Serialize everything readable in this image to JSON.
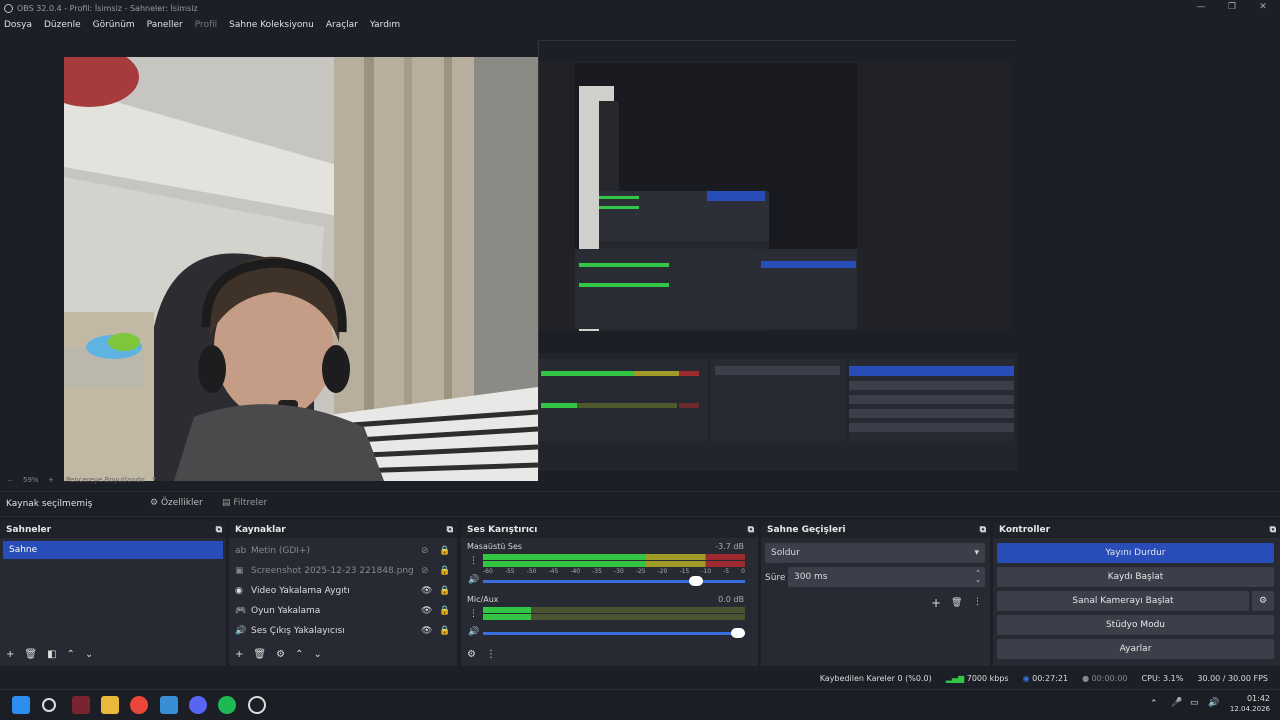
{
  "window": {
    "title": "OBS 32.0.4 - Profil: İsimsiz - Sahneler: İsimsiz",
    "controls": [
      "—",
      "❐",
      "✕"
    ]
  },
  "menu": [
    "Dosya",
    "Düzenle",
    "Görünüm",
    "Paneller",
    "Profil",
    "Sahne Koleksiyonu",
    "Araçlar",
    "Yardım"
  ],
  "preview": {
    "zoom": "59%",
    "fit_label": "Pencereye Boyutlandır"
  },
  "source_toolbar": {
    "status": "Kaynak seçilmemiş",
    "properties": "Özellikler",
    "filters": "Filtreler"
  },
  "scenes": {
    "title": "Sahneler",
    "items": [
      "Sahne"
    ]
  },
  "sources": {
    "title": "Kaynaklar",
    "items": [
      {
        "label": "Metin (GDI+)",
        "icon": "text-icon",
        "hidden": true
      },
      {
        "label": "Screenshot 2025-12-23 221848.png",
        "icon": "image-icon",
        "hidden": true
      },
      {
        "label": "Video Yakalama Aygıtı",
        "icon": "camera-icon",
        "hidden": false
      },
      {
        "label": "Oyun Yakalama",
        "icon": "gamepad-icon",
        "hidden": false
      },
      {
        "label": "Ses Çıkış Yakalayıcısı",
        "icon": "speaker-icon",
        "hidden": false
      }
    ]
  },
  "mixer": {
    "title": "Ses Karıştırıcı",
    "channels": [
      {
        "name": "Masaüstü Ses",
        "db": "-3.7 dB",
        "level": 0.62,
        "volume": 0.95
      },
      {
        "name": "Mic/Aux",
        "db": "0.0 dB",
        "level": 0.22,
        "volume": 1.0
      }
    ],
    "scale": [
      "-60",
      "-55",
      "-50",
      "-45",
      "-40",
      "-35",
      "-30",
      "-25",
      "-20",
      "-15",
      "-10",
      "-5",
      "0"
    ]
  },
  "transitions": {
    "title": "Sahne Geçişleri",
    "selected": "Soldur",
    "duration_label": "Süre",
    "duration_value": "300 ms"
  },
  "controls": {
    "title": "Kontroller",
    "stop_stream": "Yayını Durdur",
    "start_recording": "Kaydı Başlat",
    "virtual_camera": "Sanal Kamerayı Başlat",
    "studio_mode": "Stüdyo Modu",
    "settings": "Ayarlar"
  },
  "statusbar": {
    "dropped_frames": "Kaybedilen Kareler 0 (%0.0)",
    "bitrate": "7000 kbps",
    "stream_time": "00:27:21",
    "rec_time": "00:00:00",
    "cpu": "CPU: 3.1%",
    "fps": "30.00 / 30.00 FPS"
  },
  "taskbar": {
    "time": "01:42",
    "date": "12.04.2026"
  },
  "colors": {
    "accent": "#284cb8",
    "bg": "#1d1f26",
    "dock": "#272a33"
  }
}
